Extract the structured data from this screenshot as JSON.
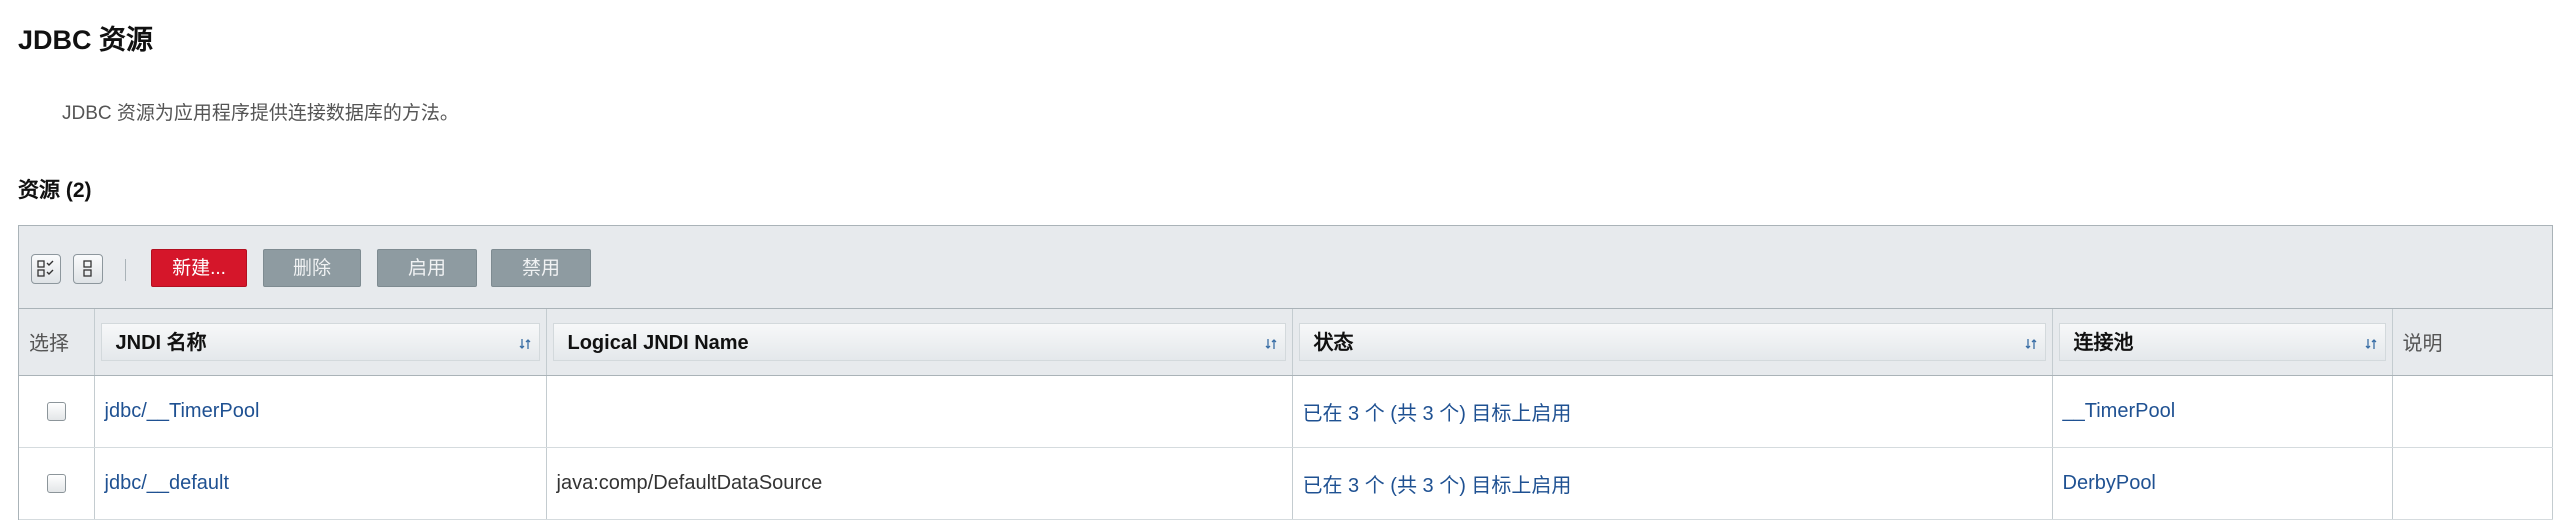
{
  "page": {
    "title": "JDBC 资源",
    "description": "JDBC 资源为应用程序提供连接数据库的方法。"
  },
  "section": {
    "title": "资源 (2)"
  },
  "toolbar": {
    "select_all_icon": "select-all-icon",
    "deselect_all_icon": "deselect-all-icon",
    "new_label": "新建...",
    "delete_label": "删除",
    "enable_label": "启用",
    "disable_label": "禁用"
  },
  "table": {
    "columns": {
      "select": "选择",
      "jndi_name": "JNDI 名称",
      "logical_jndi_name": "Logical JNDI Name",
      "status": "状态",
      "pool": "连接池",
      "description": "说明"
    },
    "rows": [
      {
        "jndi_name": "jdbc/__TimerPool",
        "logical_jndi_name": "",
        "status": "已在 3 个 (共 3 个) 目标上启用",
        "pool": "__TimerPool",
        "description": ""
      },
      {
        "jndi_name": "jdbc/__default",
        "logical_jndi_name": "java:comp/DefaultDataSource",
        "status": "已在 3 个 (共 3 个) 目标上启用",
        "pool": "DerbyPool",
        "description": ""
      }
    ]
  },
  "colors": {
    "primary_button": "#d5162a",
    "disabled_button": "#8e9ba1",
    "link": "#1f5192",
    "header_bg": "#e7eaed"
  }
}
